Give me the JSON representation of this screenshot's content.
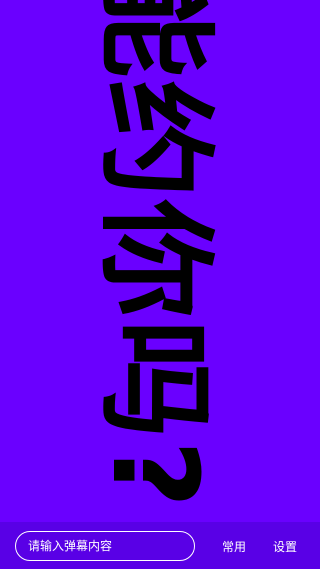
{
  "danmaku": {
    "text": "能约你吗?",
    "background_color": "#6a00ff",
    "text_color": "#000000"
  },
  "bottom_bar": {
    "input_placeholder": "请输入弹幕内容",
    "common_label": "常用",
    "settings_label": "设置"
  }
}
